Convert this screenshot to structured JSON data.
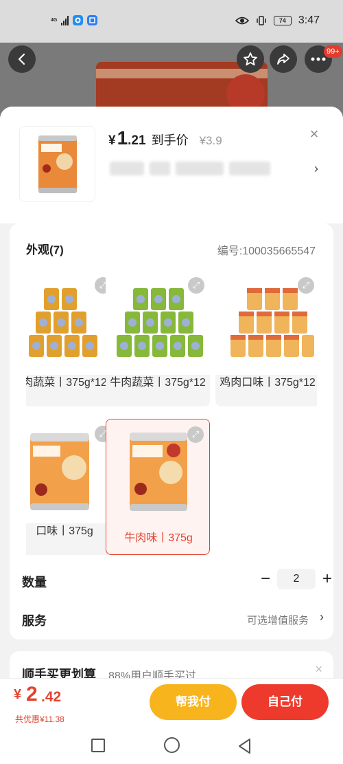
{
  "status_bar": {
    "network": "4G",
    "time": "3:47",
    "battery": "74"
  },
  "top_nav": {
    "back_icon": "chevron-left-icon",
    "favorite_icon": "star-icon",
    "share_icon": "share-icon",
    "more_icon": "more-dots-icon",
    "more_badge": "99+"
  },
  "header": {
    "price_currency": "¥",
    "price_int": "1",
    "price_dec": ".21",
    "price_label": "到手价",
    "orig_price": "¥3.9",
    "close_icon": "×",
    "chevron": "›"
  },
  "appearance": {
    "title": "外观(7)",
    "sku": "编号:100035665547",
    "options": [
      {
        "label": "肉蔬菜丨375g*12",
        "selected": false
      },
      {
        "label": "牛肉蔬菜丨375g*12",
        "selected": false
      },
      {
        "label": "鸡肉口味丨375g*12",
        "selected": false
      },
      {
        "label": "口味丨375g",
        "selected": false
      },
      {
        "label": "牛肉味丨375g",
        "selected": true
      }
    ]
  },
  "quantity": {
    "title": "数量",
    "minus": "−",
    "value": "2",
    "plus": "+"
  },
  "service": {
    "title": "服务",
    "hint": "可选增值服务",
    "chevron": "›"
  },
  "bundle": {
    "title": "顺手买更划算",
    "subtitle": "88%用户顺手买过",
    "close": "×"
  },
  "bottom": {
    "currency": "¥",
    "int": "2",
    "dec": ".42",
    "savings": "共优惠¥11.38",
    "help_pay": "帮我付",
    "self_pay": "自己付"
  },
  "colors": {
    "accent_red": "#e2432f",
    "accent_yellow": "#f8b41c"
  }
}
